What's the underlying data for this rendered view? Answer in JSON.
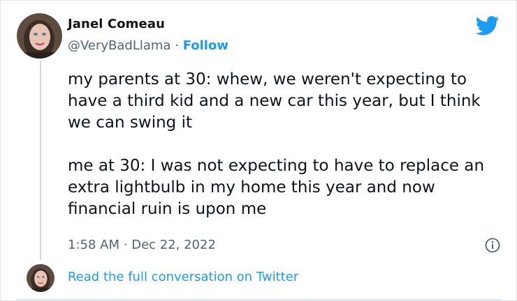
{
  "author": {
    "name": "Janel Comeau",
    "handle": "@VeryBadLlama",
    "separator": "·",
    "follow_label": "Follow"
  },
  "tweet": {
    "paragraphs": [
      "my parents at 30: whew, we weren't expecting to have a third kid and a new car this year, but I think we can swing it",
      "me at 30: I was not expecting to have to replace an extra lightbulb in my home this year and now financial ruin is upon me"
    ],
    "time": "1:58 AM",
    "separator": "·",
    "date": "Dec 22, 2022"
  },
  "footer": {
    "read_full_label": "Read the full conversation on Twitter"
  },
  "icons": {
    "brand": "twitter-bird-icon",
    "info": "info-icon"
  },
  "colors": {
    "accent": "#1d9bf0",
    "muted_text": "#536471",
    "text": "#0f1419",
    "divider": "#e1e8ed"
  }
}
